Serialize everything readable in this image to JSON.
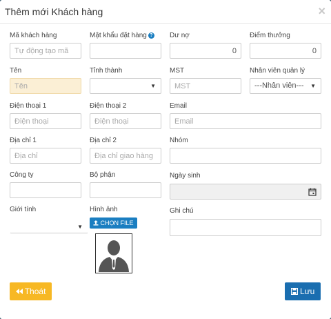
{
  "dialog": {
    "title": "Thêm mới Khách hàng",
    "close": "×"
  },
  "fields": {
    "code": {
      "label": "Mã khách hàng",
      "placeholder": "Tự động tạo mã"
    },
    "password": {
      "label": "Mật khẩu đặt hàng",
      "help": "?"
    },
    "debt": {
      "label": "Dư nợ",
      "value": "0"
    },
    "points": {
      "label": "Điểm thưởng",
      "value": "0"
    },
    "name": {
      "label": "Tên",
      "placeholder": "Tên"
    },
    "province": {
      "label": "Tỉnh thành",
      "value": ""
    },
    "tax": {
      "label": "MST",
      "placeholder": "MST"
    },
    "staff": {
      "label": "Nhân viên quản lý",
      "value": "---Nhân viên---"
    },
    "phone1": {
      "label": "Điện thoại 1",
      "placeholder": "Điện thoại"
    },
    "phone2": {
      "label": "Điện thoại 2",
      "placeholder": "Điện thoại"
    },
    "email": {
      "label": "Email",
      "placeholder": "Email"
    },
    "address1": {
      "label": "Địa chỉ 1",
      "placeholder": "Địa chỉ"
    },
    "address2": {
      "label": "Địa chỉ 2",
      "placeholder": "Địa chỉ giao hàng"
    },
    "group": {
      "label": "Nhóm"
    },
    "company": {
      "label": "Công ty"
    },
    "department": {
      "label": "Bộ phận"
    },
    "birthday": {
      "label": "Ngày sinh"
    },
    "gender": {
      "label": "Giới tính",
      "value": ""
    },
    "image": {
      "label": "Hình ảnh",
      "button": "CHỌN FILE"
    },
    "note": {
      "label": "Ghi chú"
    }
  },
  "actions": {
    "exit": "Thoát",
    "save": "Lưu"
  },
  "colors": {
    "primary": "#1a7ec1",
    "save": "#1a6eb0",
    "exit": "#f7b824",
    "highlight": "#fbefd5"
  },
  "icons": [
    "close-icon",
    "help-icon",
    "caret-down-icon",
    "calendar-icon",
    "upload-icon",
    "avatar-placeholder-icon",
    "backward-icon",
    "save-icon"
  ]
}
